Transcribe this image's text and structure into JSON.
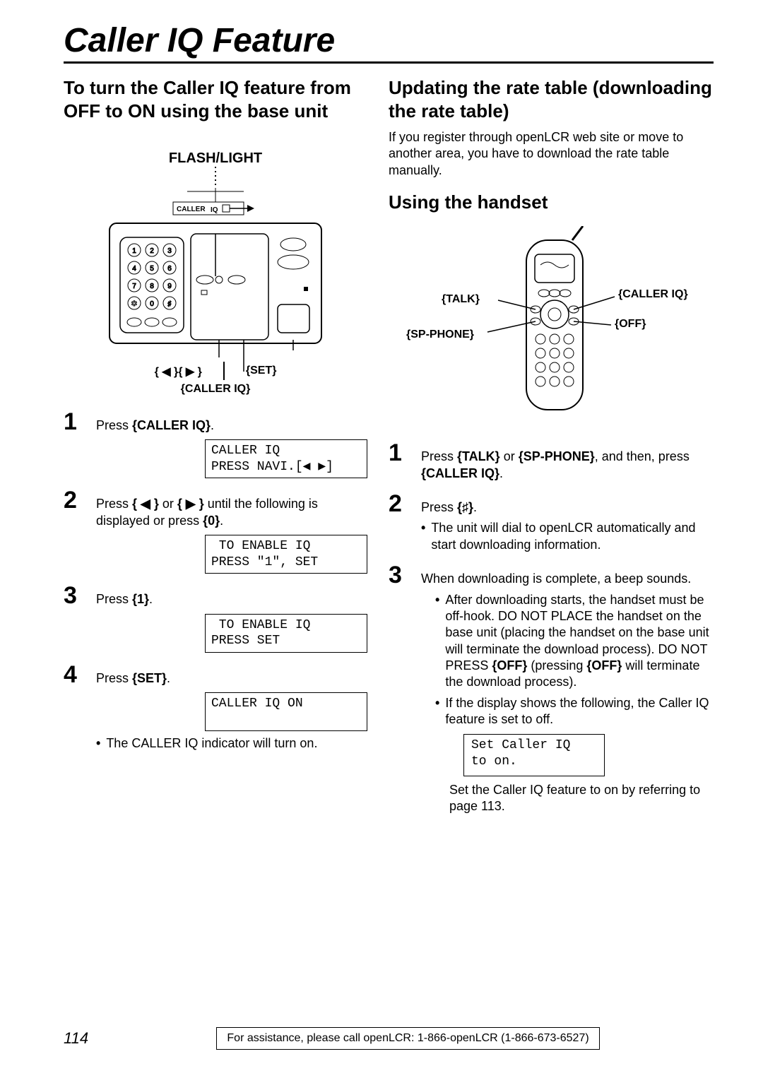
{
  "main_title": "Caller IQ Feature",
  "left": {
    "section_title": "To turn the Caller IQ feature from OFF to ON using the base unit",
    "flash_light": "FLASH/LIGHT",
    "caller_iq_text": "CALLER IQ",
    "arrow_group": "{ ◀ }{ ▶ }",
    "set_label": "{SET}",
    "below_label": "{CALLER IQ}",
    "steps": {
      "s1": {
        "num": "1",
        "pre": "Press ",
        "btn": "{CALLER IQ}",
        "post": ".",
        "display": "CALLER IQ\nPRESS NAVI.[◀ ▶]"
      },
      "s2": {
        "num": "2",
        "text_a": "Press ",
        "btn1": "{ ◀ }",
        "mid": " or ",
        "btn2": "{ ▶ }",
        "text_b": " until the following is displayed or press ",
        "btn3": "{0}",
        "text_c": ".",
        "display": " TO ENABLE IQ\nPRESS \"1\", SET"
      },
      "s3": {
        "num": "3",
        "pre": "Press ",
        "btn": "{1}",
        "post": ".",
        "display": " TO ENABLE IQ\nPRESS SET"
      },
      "s4": {
        "num": "4",
        "pre": "Press ",
        "btn": "{SET}",
        "post": ".",
        "display": "CALLER IQ ON\n ",
        "bullet": "The CALLER IQ indicator will turn on."
      }
    }
  },
  "right": {
    "section_title": "Updating the rate table (downloading the rate table)",
    "intro": "If you register through openLCR web site or move to another area, you have to download the rate table manually.",
    "sub_title": "Using the handset",
    "labels": {
      "talk": "{TALK}",
      "sp_phone": "{SP-PHONE}",
      "caller_iq": "{CALLER IQ}",
      "off": "{OFF}"
    },
    "steps": {
      "s1": {
        "num": "1",
        "pre": "Press ",
        "btn1": "{TALK}",
        "mid": " or ",
        "btn2": "{SP-PHONE}",
        "text": ", and then, press ",
        "btn3": "{CALLER IQ}",
        "post": "."
      },
      "s2": {
        "num": "2",
        "pre": "Press ",
        "btn": "{♯}",
        "post": ".",
        "bullet": "The unit will dial to openLCR automatically and start downloading information."
      },
      "s3": {
        "num": "3",
        "line": "When downloading is complete, a beep sounds.",
        "bullet1_a": "After downloading starts, the handset must be off-hook. DO NOT PLACE the handset on the base unit (placing the handset on the base unit will terminate the download process). DO NOT PRESS ",
        "b1_btn1": "{OFF}",
        "bullet1_b": " (pressing ",
        "b1_btn2": "{OFF}",
        "bullet1_c": " will terminate the download process).",
        "bullet2": "If the display shows the following, the Caller IQ feature is set to off.",
        "display": "Set Caller IQ\nto on.",
        "tail": "Set the Caller IQ feature to on by referring to page 113."
      }
    }
  },
  "footer": {
    "page": "114",
    "text": "For assistance, please call openLCR: 1-866-openLCR (1-866-673-6527)"
  }
}
